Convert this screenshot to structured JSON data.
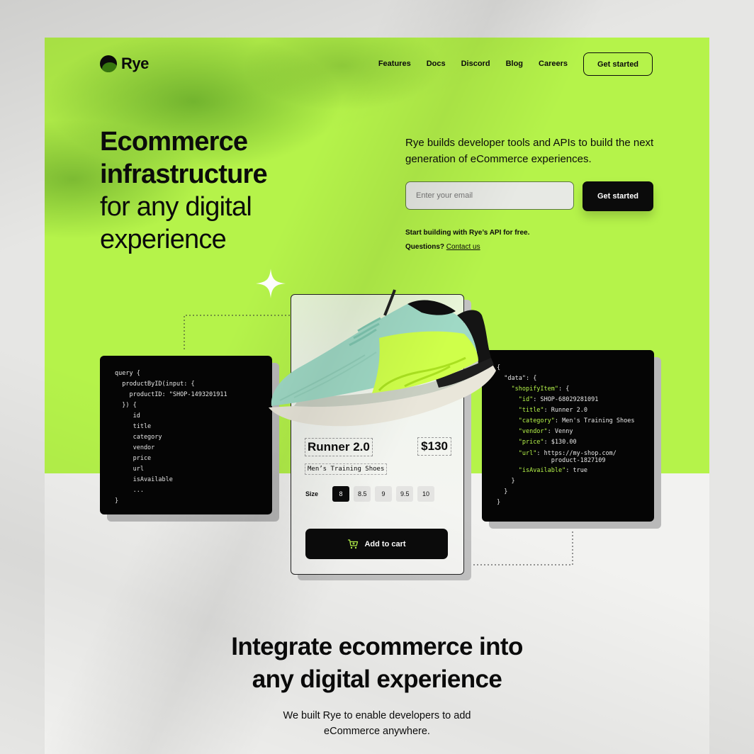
{
  "brand": {
    "name": "Rye"
  },
  "nav": {
    "items": [
      "Features",
      "Docs",
      "Discord",
      "Blog",
      "Careers"
    ],
    "cta_label": "Get started"
  },
  "hero": {
    "headline_bold": [
      "Ecommerce",
      "infrastructure"
    ],
    "headline_regular": [
      "for any digital",
      "experience"
    ],
    "lede": "Rye builds developer tools and APIs to build the next generation of eCommerce experiences.",
    "email_placeholder": "Enter your email",
    "cta_label": "Get started",
    "note_line1": "Start building with Rye’s API for free.",
    "note_question": "Questions?",
    "note_link": "Contact us"
  },
  "query_code": [
    "query {",
    "  productByID(input: {",
    "    productID: \"SHOP-1493201911",
    "  }) {",
    "     id",
    "     title",
    "     category",
    "     vendor",
    "     price",
    "     url",
    "     isAvailable",
    "     ...",
    "}"
  ],
  "response_code": {
    "open": "{",
    "data_key": "\"data\"",
    "item_key": "\"shopifyItem\"",
    "fields": [
      {
        "key": "\"id\"",
        "value": "SHOP-68029281091"
      },
      {
        "key": "\"title\"",
        "value": "Runner 2.0"
      },
      {
        "key": "\"category\"",
        "value": "Men's Training Shoes"
      },
      {
        "key": "\"vendor\"",
        "value": "Venny"
      },
      {
        "key": "\"price\"",
        "value": "$130.00"
      },
      {
        "key": "\"url\"",
        "value": "https://my-shop.com/",
        "value_cont": "product-1827109"
      },
      {
        "key": "\"isAvailable\"",
        "value": "true"
      }
    ]
  },
  "product": {
    "title": "Runner 2.0",
    "price": "$130",
    "type": "Men’s Training Shoes",
    "size_label": "Size",
    "sizes": [
      "8",
      "8.5",
      "9",
      "9.5",
      "10"
    ],
    "selected_size": "8",
    "cart_label": "Add to cart"
  },
  "section2": {
    "title_line1": "Integrate ecommerce into",
    "title_line2": "any digital experience",
    "sub_line1": "We built Rye to enable developers to add",
    "sub_line2": "eCommerce anywhere."
  },
  "colors": {
    "accent": "#b5f34a",
    "ink": "#0b0b0b",
    "page": "#f2f2f0"
  },
  "icons": [
    "sparkle-icon",
    "cart-icon",
    "rye-logo-icon"
  ]
}
